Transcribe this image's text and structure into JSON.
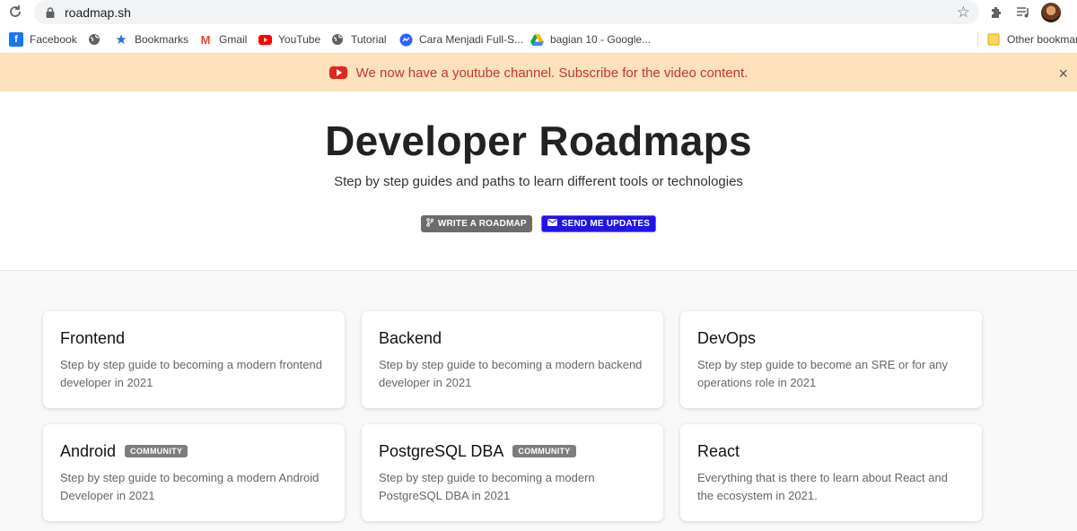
{
  "browser": {
    "url": "roadmap.sh",
    "bookmarks": [
      {
        "label": "Facebook",
        "icon": "facebook-icon"
      },
      {
        "label": "",
        "icon": "globe-icon"
      },
      {
        "label": "Bookmarks",
        "icon": "star-icon"
      },
      {
        "label": "Gmail",
        "icon": "gmail-icon"
      },
      {
        "label": "YouTube",
        "icon": "youtube-icon"
      },
      {
        "label": "Tutorial",
        "icon": "globe-icon"
      },
      {
        "label": "Cara Menjadi Full-S...",
        "icon": "site-icon"
      },
      {
        "label": "bagian 10 - Google...",
        "icon": "drive-icon"
      }
    ],
    "other_bookmarks": "Other bookmarks"
  },
  "banner": {
    "text": "We now have a youtube channel. Subscribe for the video content.",
    "close": "×"
  },
  "hero": {
    "title": "Developer Roadmaps",
    "subtitle": "Step by step guides and paths to learn different tools or technologies",
    "write_label": "WRITE A ROADMAP",
    "updates_label": "SEND ME UPDATES"
  },
  "cards": [
    {
      "title": "Frontend",
      "badge": "",
      "desc": "Step by step guide to becoming a modern frontend developer in 2021"
    },
    {
      "title": "Backend",
      "badge": "",
      "desc": "Step by step guide to becoming a modern backend developer in 2021"
    },
    {
      "title": "DevOps",
      "badge": "",
      "desc": "Step by step guide to become an SRE or for any operations role in 2021"
    },
    {
      "title": "Android",
      "badge": "COMMUNITY",
      "desc": "Step by step guide to becoming a modern Android Developer in 2021"
    },
    {
      "title": "PostgreSQL DBA",
      "badge": "COMMUNITY",
      "desc": "Step by step guide to becoming a modern PostgreSQL DBA in 2021"
    },
    {
      "title": "React",
      "badge": "",
      "desc": "Everything that is there to learn about React and the ecosystem in 2021."
    }
  ]
}
